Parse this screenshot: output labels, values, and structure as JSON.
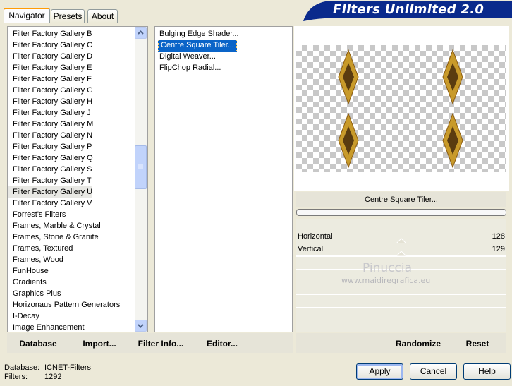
{
  "tabs": [
    "Navigator",
    "Presets",
    "About"
  ],
  "banner_title": "Filters Unlimited 2.0",
  "categories": [
    "Filter Factory Gallery B",
    "Filter Factory Gallery C",
    "Filter Factory Gallery D",
    "Filter Factory Gallery E",
    "Filter Factory Gallery F",
    "Filter Factory Gallery G",
    "Filter Factory Gallery H",
    "Filter Factory Gallery J",
    "Filter Factory Gallery M",
    "Filter Factory Gallery N",
    "Filter Factory Gallery P",
    "Filter Factory Gallery Q",
    "Filter Factory Gallery S",
    "Filter Factory Gallery T",
    "Filter Factory Gallery U",
    "Filter Factory Gallery V",
    "Forrest's Filters",
    "Frames, Marble & Crystal",
    "Frames, Stone & Granite",
    "Frames, Textured",
    "Frames, Wood",
    "FunHouse",
    "Gradients",
    "Graphics Plus",
    "Horizonaus Pattern Generators",
    "I-Decay",
    "Image Enhancement"
  ],
  "selected_category_index": 14,
  "filters": [
    "Bulging Edge Shader...",
    "Centre Square Tiler...",
    "Digital Weaver...",
    "FlipChop Radial..."
  ],
  "selected_filter_index": 1,
  "toolbar": {
    "database": "Database",
    "import": "Import...",
    "filter_info": "Filter Info...",
    "editor": "Editor...",
    "randomize": "Randomize",
    "reset": "Reset"
  },
  "preview": {
    "filter_name": "Centre Square Tiler...",
    "progress": 0
  },
  "sliders": [
    {
      "label": "Horizontal",
      "value": "128",
      "level": 0.5
    },
    {
      "label": "Vertical",
      "value": "129",
      "level": 0.5
    }
  ],
  "watermark": {
    "line1": "Pinuccia",
    "line2": "www.maidiregrafica.eu"
  },
  "status": {
    "database_label": "Database:",
    "database_value": "ICNET-Filters",
    "filters_label": "Filters:",
    "filters_value": "1292"
  },
  "buttons": {
    "apply": "Apply",
    "cancel": "Cancel",
    "help": "Help"
  },
  "colors": {
    "banner": "#0a2a8c",
    "selection": "#0a64c8",
    "tab_accent": "#ff9b05",
    "diamond_gold": "#c89a2a",
    "diamond_dark": "#5a3c10"
  }
}
